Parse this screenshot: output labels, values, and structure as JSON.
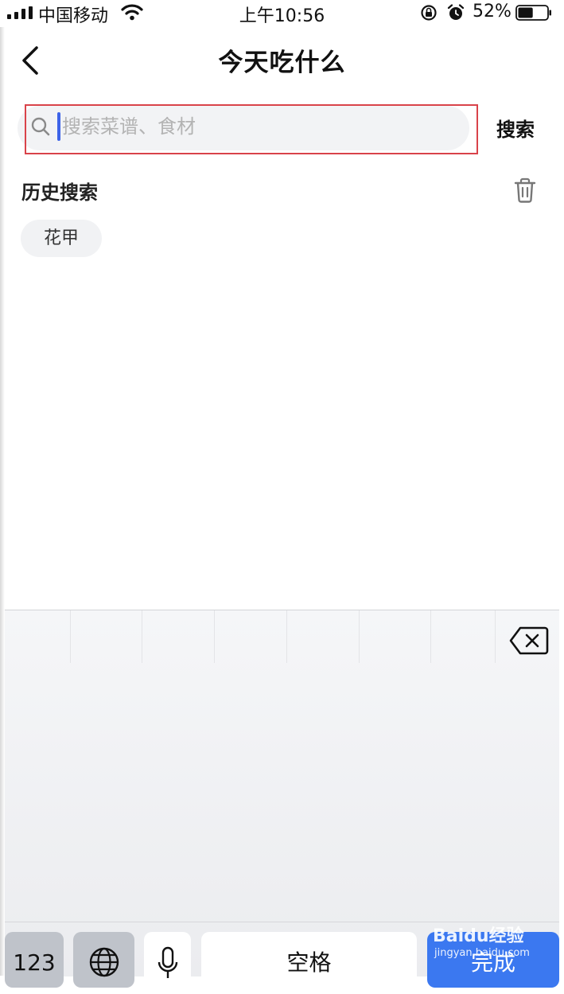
{
  "status_bar": {
    "carrier": "中国移动",
    "time": "上午10:56",
    "battery_percent": "52%",
    "battery_level": 0.52,
    "icons": [
      "signal-icon",
      "wifi-icon",
      "rotation-lock-icon",
      "alarm-icon",
      "battery-icon"
    ]
  },
  "nav": {
    "title": "今天吃什么",
    "back_icon": "chevron-left-icon"
  },
  "search": {
    "placeholder": "搜索菜谱、食材",
    "value": "",
    "button_label": "搜索",
    "highlight_color": "#d9434a",
    "caret_color": "#3d63e8"
  },
  "history": {
    "title": "历史搜索",
    "items": [
      "花甲"
    ],
    "clear_icon": "trash-icon"
  },
  "keyboard": {
    "key_123": "123",
    "space_label": "空格",
    "done_label": "完成",
    "done_color": "#3b78f0",
    "icons": [
      "delete-icon",
      "globe-icon",
      "microphone-icon"
    ]
  },
  "watermark": {
    "brand": "Baidu经验",
    "url": "jingyan.baidu.com"
  }
}
